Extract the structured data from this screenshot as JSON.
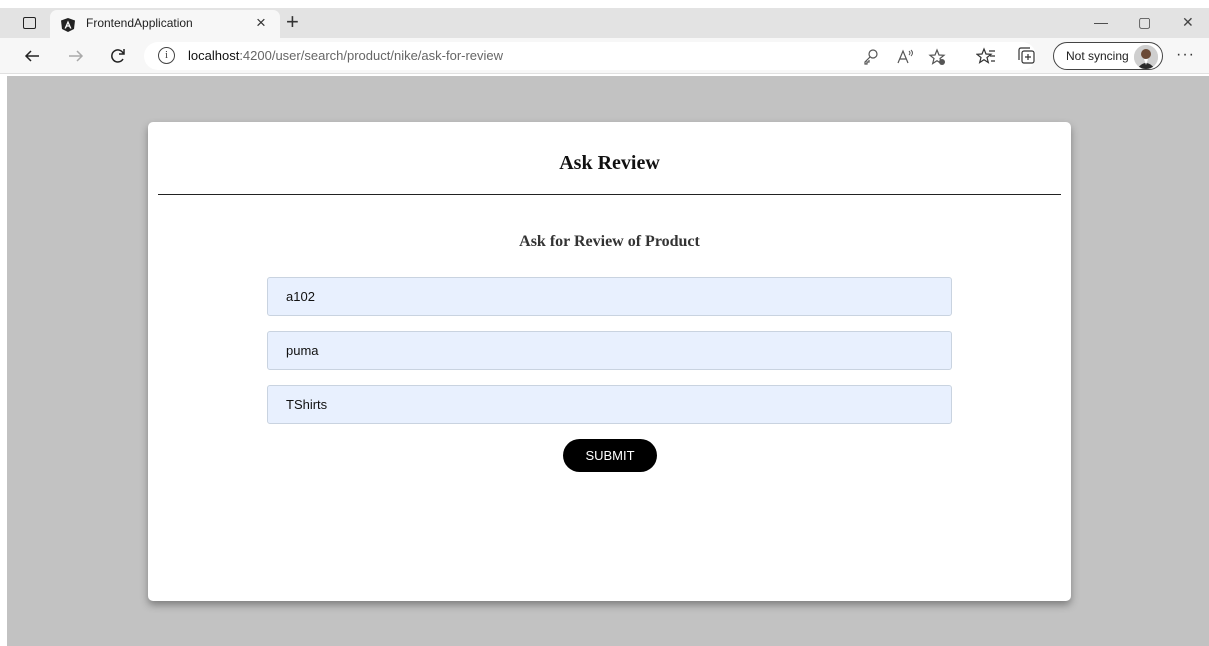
{
  "browser": {
    "tab_title": "FrontendApplication",
    "tab_close": "×",
    "new_tab": "+",
    "url_host": "localhost",
    "url_rest": ":4200/user/search/product/nike/ask-for-review",
    "sync_label": "Not syncing",
    "more": "···",
    "info_glyph": "i",
    "window_minimize": "—",
    "window_restore": "▢",
    "window_close": "✕"
  },
  "page": {
    "title": "Ask Review",
    "subtitle": "Ask for Review of Product",
    "fields": [
      {
        "value": "a102"
      },
      {
        "value": "puma"
      },
      {
        "value": "TShirts"
      }
    ],
    "submit_label": "SUBMIT"
  },
  "colors": {
    "background": "#c2c2c2",
    "card": "#ffffff",
    "field_bg": "#e8f0fe",
    "button": "#000000"
  },
  "icons": [
    "tab-actions-icon",
    "angular-icon",
    "back-icon",
    "forward-icon",
    "refresh-icon",
    "info-icon",
    "key-icon",
    "read-aloud-icon",
    "favorite-add-icon",
    "favorites-icon",
    "collections-icon",
    "avatar",
    "more-icon"
  ]
}
